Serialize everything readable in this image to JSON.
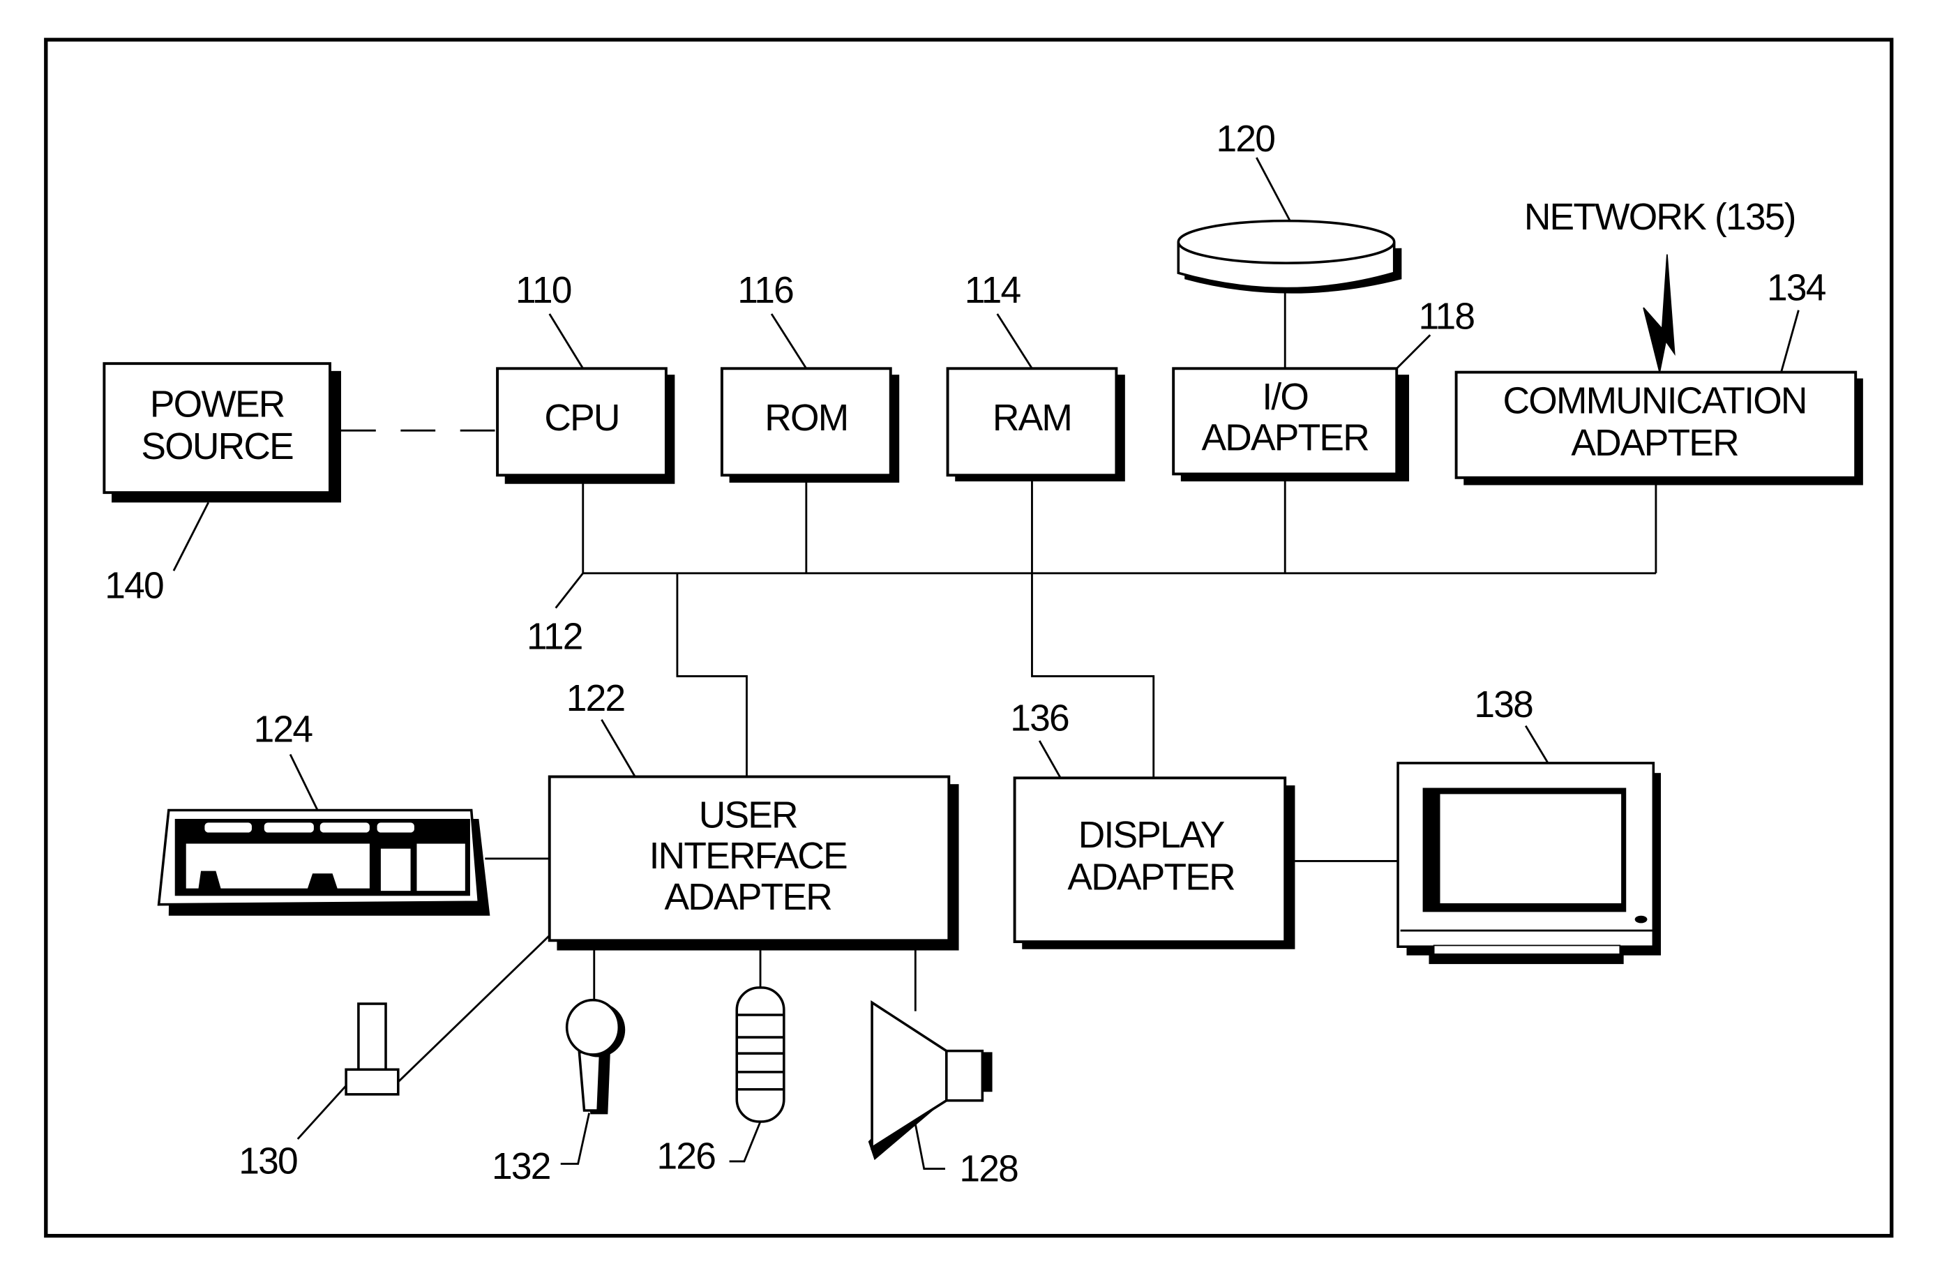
{
  "figure": {
    "components": {
      "power_source": {
        "line1": "POWER",
        "line2": "SOURCE",
        "ref": "140"
      },
      "cpu": {
        "label": "CPU",
        "ref": "110"
      },
      "rom": {
        "label": "ROM",
        "ref": "116"
      },
      "ram": {
        "label": "RAM",
        "ref": "114"
      },
      "io_adapter": {
        "line1": "I/O",
        "line2": "ADAPTER",
        "ref": "118"
      },
      "disk": {
        "ref": "120"
      },
      "comm_adapter": {
        "line1": "COMMUNICATION",
        "line2": "ADAPTER",
        "ref": "134"
      },
      "network": {
        "label": "NETWORK (135)"
      },
      "bus": {
        "ref": "112"
      },
      "ui_adapter": {
        "line1": "USER",
        "line2": "INTERFACE",
        "line3": "ADAPTER",
        "ref": "122"
      },
      "display_adapter": {
        "line1": "DISPLAY",
        "line2": "ADAPTER",
        "ref": "136"
      },
      "monitor": {
        "ref": "138"
      },
      "keyboard": {
        "ref": "124"
      },
      "mouse": {
        "ref": "130"
      },
      "microphone": {
        "ref": "132"
      },
      "touch_device": {
        "ref": "126"
      },
      "speaker": {
        "ref": "128"
      }
    }
  }
}
